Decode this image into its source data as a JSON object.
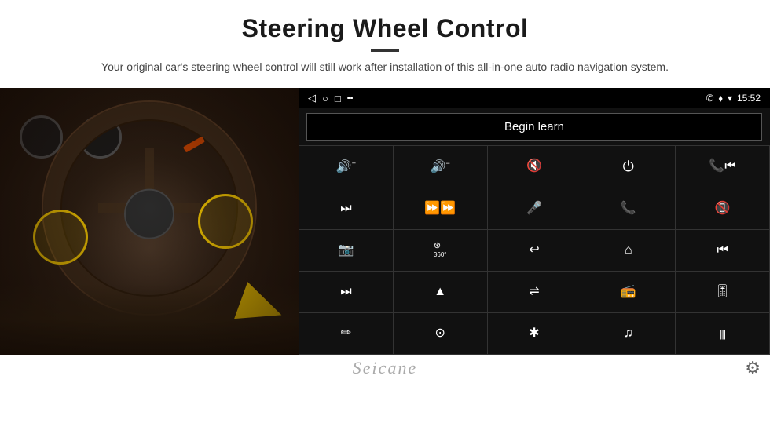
{
  "header": {
    "title": "Steering Wheel Control",
    "subtitle": "Your original car's steering wheel control will still work after installation of this all-in-one auto radio navigation system."
  },
  "status_bar": {
    "nav_back": "◁",
    "nav_home": "○",
    "nav_square": "□",
    "signal": "▪▪",
    "phone": "✆",
    "location": "⬧",
    "wifi": "▾",
    "time": "15:52"
  },
  "begin_learn": {
    "label": "Begin learn"
  },
  "controls": [
    {
      "icon": "🔊+",
      "row": 1,
      "col": 1
    },
    {
      "icon": "🔊-",
      "row": 1,
      "col": 2
    },
    {
      "icon": "🔇",
      "row": 1,
      "col": 3
    },
    {
      "icon": "⏻",
      "row": 1,
      "col": 4
    },
    {
      "icon": "⏮",
      "row": 1,
      "col": 5
    },
    {
      "icon": "⏭",
      "row": 2,
      "col": 1
    },
    {
      "icon": "⏩",
      "row": 2,
      "col": 2
    },
    {
      "icon": "🎤",
      "row": 2,
      "col": 3
    },
    {
      "icon": "📞",
      "row": 2,
      "col": 4
    },
    {
      "icon": "📵",
      "row": 2,
      "col": 5
    },
    {
      "icon": "📷",
      "row": 3,
      "col": 1
    },
    {
      "icon": "360",
      "row": 3,
      "col": 2
    },
    {
      "icon": "↩",
      "row": 3,
      "col": 3
    },
    {
      "icon": "⌂",
      "row": 3,
      "col": 4
    },
    {
      "icon": "⏮",
      "row": 3,
      "col": 5
    },
    {
      "icon": "⏭",
      "row": 4,
      "col": 1
    },
    {
      "icon": "▲",
      "row": 4,
      "col": 2
    },
    {
      "icon": "⇌",
      "row": 4,
      "col": 3
    },
    {
      "icon": "📻",
      "row": 4,
      "col": 4
    },
    {
      "icon": "🎚",
      "row": 4,
      "col": 5
    },
    {
      "icon": "✏",
      "row": 5,
      "col": 1
    },
    {
      "icon": "⊙",
      "row": 5,
      "col": 2
    },
    {
      "icon": "✱",
      "row": 5,
      "col": 3
    },
    {
      "icon": "♪",
      "row": 5,
      "col": 4
    },
    {
      "icon": "|||",
      "row": 5,
      "col": 5
    }
  ],
  "bottom": {
    "brand": "Seicane",
    "gear_icon": "⚙"
  },
  "colors": {
    "panel_bg": "#111111",
    "grid_gap": "#333333",
    "btn_bg": "#111111",
    "status_bg": "#000000",
    "accent_yellow": "#f5c800"
  }
}
